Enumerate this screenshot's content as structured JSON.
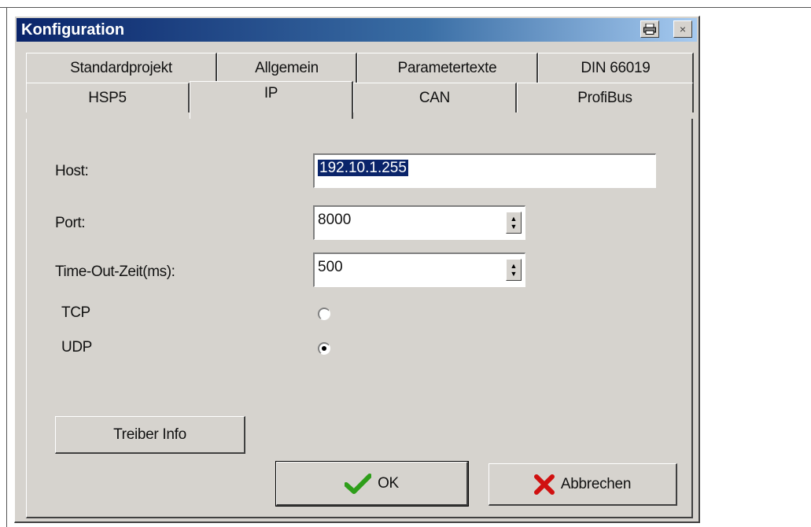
{
  "window": {
    "title": "Konfiguration",
    "print_icon": "printer-icon",
    "close_icon": "close-icon",
    "close_glyph": "×"
  },
  "tabs": {
    "row1": [
      "Standardprojekt",
      "Allgemein",
      "Parametertexte",
      "DIN 66019"
    ],
    "row2": [
      "HSP5",
      "IP",
      "CAN",
      "ProfiBus"
    ],
    "active": "IP"
  },
  "form": {
    "host_label": "Host:",
    "host_value": "192.10.1.255",
    "port_label": "Port:",
    "port_value": "8000",
    "timeout_label": "Time-Out-Zeit(ms):",
    "timeout_value": "500",
    "tcp_label": "TCP",
    "udp_label": "UDP",
    "protocol_selected": "UDP"
  },
  "buttons": {
    "driver_info": "Treiber Info",
    "ok": "OK",
    "cancel": "Abbrechen"
  },
  "colors": {
    "titlebar_start": "#0a246a",
    "dialog_bg": "#d6d3ce",
    "ok_check": "#2e9e1a",
    "cancel_x": "#d01010"
  }
}
